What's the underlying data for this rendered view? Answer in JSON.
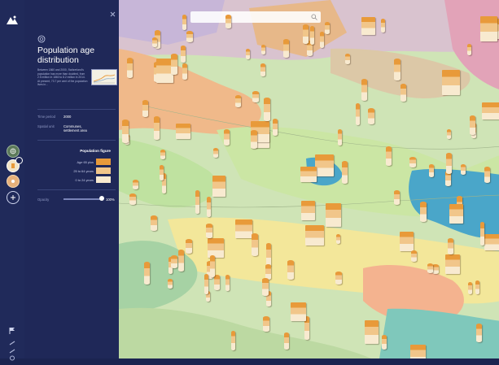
{
  "panel": {
    "title": "Population age distribution",
    "description": "Between 1860 and 2000, Switzerland's population has more than doubled, from 2.5 million in 1860 to 8.2 million in 2014. At present, 73.7 per cent of the population lives in...",
    "time_period_label": "Time period",
    "time_period_value": "2000",
    "spatial_unit_label": "Spatial unit",
    "spatial_unit_value": "Communes, settlement area",
    "legend_title": "Population figure",
    "legend": [
      {
        "label": "Age 65 plus",
        "color": "#e89a3a"
      },
      {
        "label": "25 to 64 years",
        "color": "#f1c68a"
      },
      {
        "label": "0 to 24 years",
        "color": "#f8ead0"
      }
    ],
    "opacity_label": "Opacity",
    "opacity_value": "100%",
    "opacity_level": 1.0
  },
  "icons": {
    "logo": "logo-icon",
    "close": "close-icon",
    "theme": "theme-icon",
    "search": "search-icon",
    "layer_globe": "globe-icon",
    "layer_population": "population-icon",
    "layer_other": "layer-icon",
    "add_layer": "add-icon",
    "flag": "flag-icon",
    "tool_a": "tool-icon",
    "tool_b": "share-icon",
    "tool_c": "settings-icon"
  },
  "colors": {
    "sidebar": "#1f2858",
    "accent": "#e89a3a",
    "lake": "#4aa6c9"
  }
}
